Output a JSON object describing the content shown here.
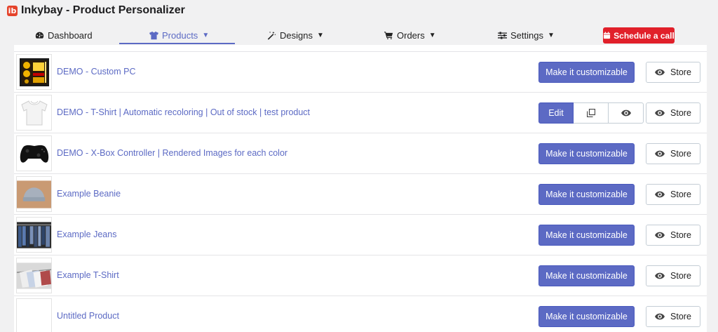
{
  "app": {
    "title": "Inkybay - Product Personalizer",
    "logo_letter": "ib"
  },
  "nav": {
    "items": [
      {
        "label": "Dashboard",
        "icon": "dashboard-icon",
        "has_caret": false
      },
      {
        "label": "Products",
        "icon": "tshirt-icon",
        "has_caret": true,
        "active": true
      },
      {
        "label": "Designs",
        "icon": "magic-wand-icon",
        "has_caret": true
      },
      {
        "label": "Orders",
        "icon": "cart-icon",
        "has_caret": true
      },
      {
        "label": "Settings",
        "icon": "sliders-icon",
        "has_caret": true
      }
    ],
    "caret": "▼",
    "schedule_label": "Schedule a call",
    "accent_color": "#5c6ac4",
    "schedule_color": "#e1202a"
  },
  "products": [
    {
      "title": "DEMO - Custom PC",
      "thumb": "custom-pc",
      "action": "Make it customizable"
    },
    {
      "title": "DEMO - T-Shirt | Automatic recoloring | Out of stock | test product",
      "thumb": "white-tshirt",
      "action": "edit-group",
      "edit_label": "Edit"
    },
    {
      "title": "DEMO - X-Box Controller | Rendered Images for each color",
      "thumb": "controller",
      "action": "Make it customizable"
    },
    {
      "title": "Example Beanie",
      "thumb": "beanie",
      "action": "Make it customizable"
    },
    {
      "title": "Example Jeans",
      "thumb": "jeans",
      "action": "Make it customizable"
    },
    {
      "title": "Example T-Shirt",
      "thumb": "tshirts-hanging",
      "action": "Make it customizable"
    },
    {
      "title": "Untitled Product",
      "thumb": "blank",
      "action": "Make it customizable"
    }
  ],
  "store_label": "Store"
}
